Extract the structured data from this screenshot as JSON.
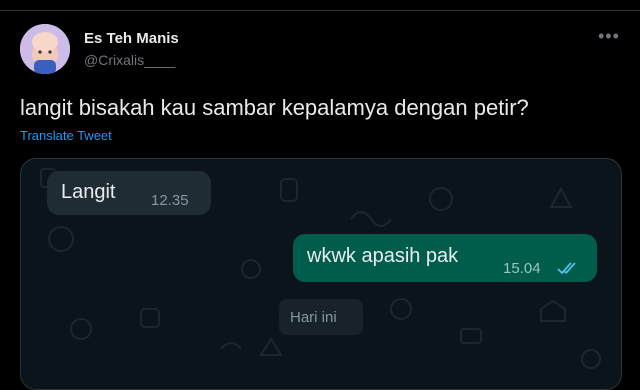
{
  "tweet": {
    "display_name": "Es Teh Manis",
    "handle": "@Crixalis____",
    "text": "langit bisakah kau sambar kepalamya dengan petir?",
    "translate_label": "Translate Tweet",
    "more_icon": "more-dots-icon"
  },
  "chat": {
    "incoming": {
      "text": "Langit",
      "time": "12.35"
    },
    "outgoing": {
      "text": "wkwk apasih pak",
      "time": "15.04",
      "status_icon": "double-check-icon"
    },
    "date_separator": "Hari ini"
  },
  "colors": {
    "background": "#000000",
    "link": "#1d9bf0",
    "incoming_bubble": "#202c33",
    "outgoing_bubble": "#005c4b",
    "read_ticks": "#53bdeb"
  }
}
